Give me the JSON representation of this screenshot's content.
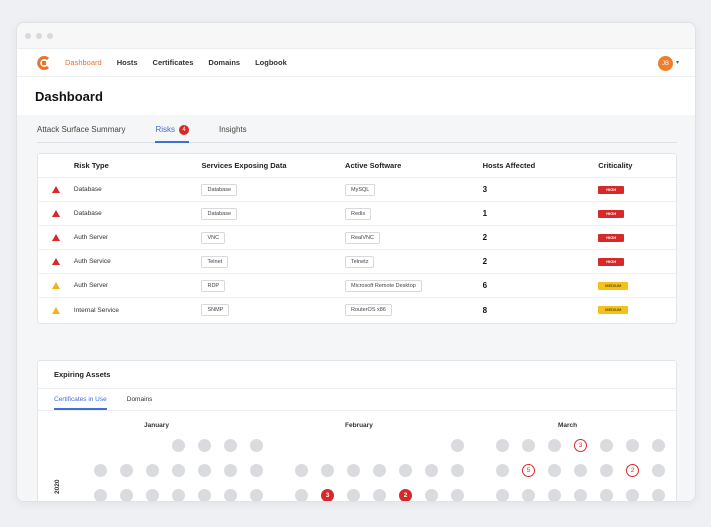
{
  "nav": {
    "items": [
      "Dashboard",
      "Hosts",
      "Certificates",
      "Domains",
      "Logbook"
    ],
    "avatar": "JB"
  },
  "page_title": "Dashboard",
  "tabs": [
    {
      "label": "Attack Surface Summary"
    },
    {
      "label": "Risks",
      "badge": "4"
    },
    {
      "label": "Insights"
    }
  ],
  "risk_table": {
    "headers": [
      "Risk Type",
      "Services Exposing Data",
      "Active Software",
      "Hosts Affected",
      "Criticality"
    ],
    "rows": [
      {
        "level": "high",
        "type": "Database",
        "service": "Database",
        "software": "MySQL",
        "hosts": "3",
        "criticality": "HIGH"
      },
      {
        "level": "high",
        "type": "Database",
        "service": "Database",
        "software": "Redis",
        "hosts": "1",
        "criticality": "HIGH"
      },
      {
        "level": "high",
        "type": "Auth Server",
        "service": "VNC",
        "software": "RealVNC",
        "hosts": "2",
        "criticality": "HIGH"
      },
      {
        "level": "high",
        "type": "Auth Service",
        "service": "Telnet",
        "software": "Telnetz",
        "hosts": "2",
        "criticality": "HIGH"
      },
      {
        "level": "medium",
        "type": "Auth Server",
        "service": "RDP",
        "software": "Microsoft Remote Desktop",
        "hosts": "6",
        "criticality": "MEDIUM"
      },
      {
        "level": "medium",
        "type": "Internal Service",
        "service": "SNMP",
        "software": "RouterOS x86",
        "hosts": "8",
        "criticality": "MEDIUM"
      }
    ]
  },
  "expiring": {
    "title": "Expiring Assets",
    "tabs": [
      "Certificates in Use",
      "Domains"
    ],
    "months": [
      "January",
      "February",
      "March"
    ],
    "year": "2020",
    "markers": {
      "mar_r1": "3",
      "mar_r2a": "5",
      "mar_r2b": "2",
      "feb_r3a": "3",
      "feb_r3b": "2"
    }
  },
  "colors": {
    "accent": "#3f6fd8",
    "brand": "#e8732e",
    "danger": "#d62a2a",
    "warning": "#f2c21b"
  }
}
